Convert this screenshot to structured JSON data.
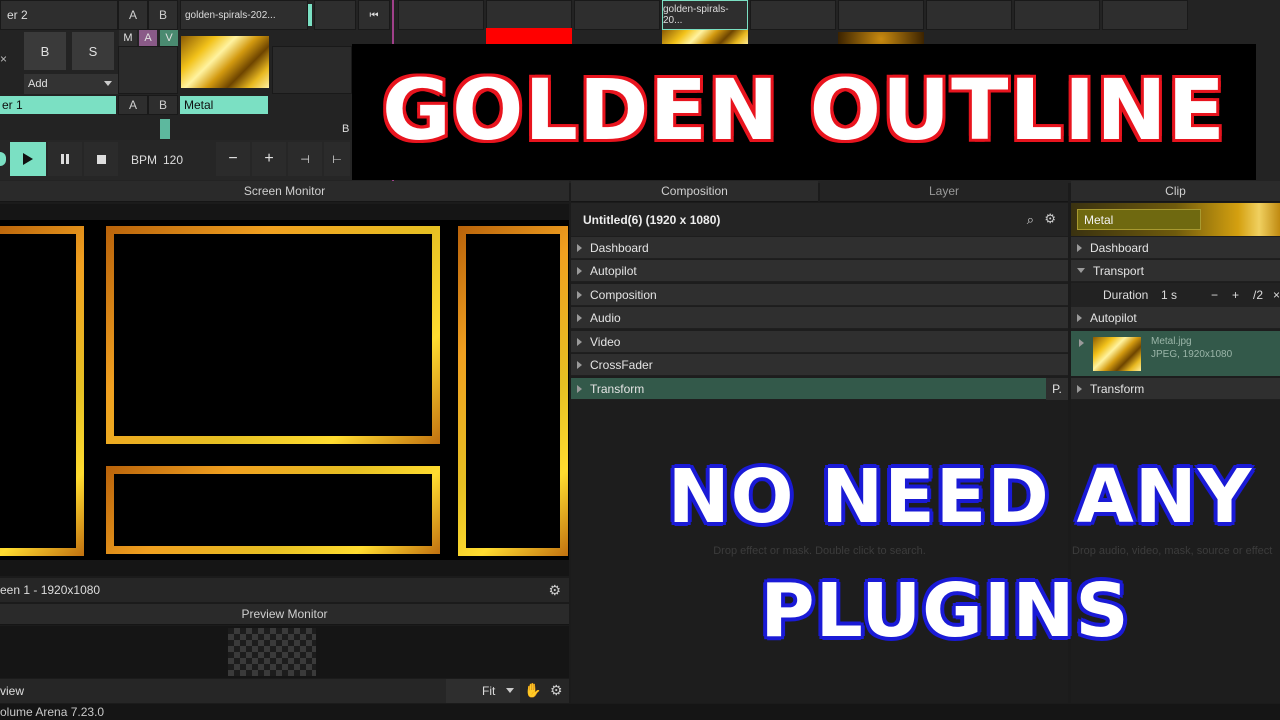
{
  "top": {
    "layer2_label": "er 2",
    "layer1_label": "er 1",
    "ab_a": "A",
    "ab_b": "B",
    "clip_name_top": "golden-spirals-202...",
    "clip_name_top2": "golden-spirals-20...",
    "mix_b": "B",
    "mix_s": "S",
    "m": "M",
    "a": "A",
    "v": "V",
    "add_label": "Add",
    "clip_metal": "Metal",
    "side_b": "B"
  },
  "transport": {
    "bpm_label": "BPM",
    "bpm_value": "120",
    "minus": "−",
    "plus": "+"
  },
  "overlay": {
    "headline": "GOLDEN OUTLINE",
    "sub1": "NO NEED ANY",
    "sub2": "PLUGINS"
  },
  "screen_monitor": {
    "title": "Screen Monitor",
    "footer": "een 1 - 1920x1080"
  },
  "preview_monitor": {
    "title": "Preview Monitor",
    "footer": "view",
    "fit": "Fit"
  },
  "composition": {
    "tab_composition": "Composition",
    "tab_layer": "Layer",
    "title": "Untitled(6) (1920 x 1080)",
    "items": [
      "Dashboard",
      "Autopilot",
      "Composition",
      "Audio",
      "Video",
      "CrossFader",
      "Transform"
    ],
    "transform_btn": "P.",
    "drop_hint": "Drop effect or mask. Double click to search."
  },
  "clip": {
    "tab": "Clip",
    "name": "Metal",
    "dashboard": "Dashboard",
    "transport": "Transport",
    "duration_label": "Duration",
    "duration_value": "1 s",
    "dur_minus": "−",
    "dur_plus": "+",
    "dur_div": "/2",
    "dur_x": "×",
    "autopilot": "Autopilot",
    "file_name": "Metal.jpg",
    "file_info": "JPEG, 1920x1080",
    "transform": "Transform",
    "drop_hint": "Drop audio, video, mask, source or effect"
  },
  "status": {
    "version": "olume Arena 7.23.0"
  },
  "colors": {
    "mint": "#7be0c3",
    "red_clip": "#ff0000",
    "overlay_red": "#e8141e",
    "overlay_blue": "#1a1ad6"
  }
}
